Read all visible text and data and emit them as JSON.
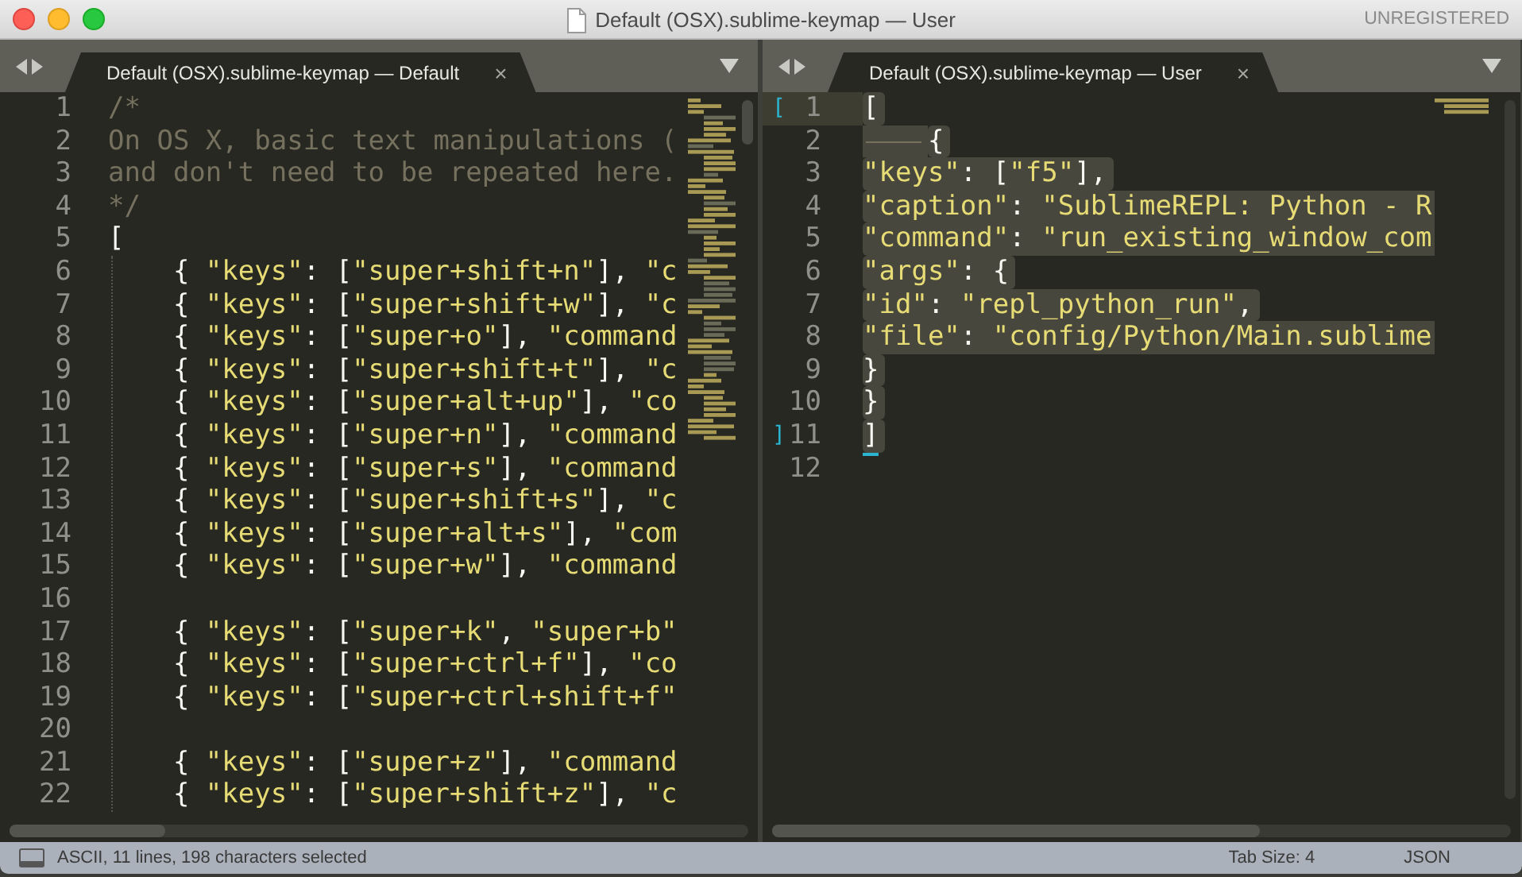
{
  "window": {
    "title": "Default (OSX).sublime-keymap — User",
    "license": "UNREGISTERED"
  },
  "panes": [
    {
      "tab": {
        "label": "Default (OSX).sublime-keymap — Default",
        "close": "×"
      },
      "lines": [
        {
          "number": "1",
          "kind": "comment",
          "text": "/*"
        },
        {
          "number": "2",
          "kind": "comment",
          "text": "On OS X, basic text manipulations ("
        },
        {
          "number": "3",
          "kind": "comment",
          "text": "and don't need to be repeated here."
        },
        {
          "number": "4",
          "kind": "comment",
          "text": "*/"
        },
        {
          "number": "5",
          "kind": "code",
          "text": "["
        },
        {
          "number": "6",
          "kind": "code",
          "text": "    { \"keys\": [\"super+shift+n\"], \"c"
        },
        {
          "number": "7",
          "kind": "code",
          "text": "    { \"keys\": [\"super+shift+w\"], \"c"
        },
        {
          "number": "8",
          "kind": "code",
          "text": "    { \"keys\": [\"super+o\"], \"command"
        },
        {
          "number": "9",
          "kind": "code",
          "text": "    { \"keys\": [\"super+shift+t\"], \"c"
        },
        {
          "number": "10",
          "kind": "code",
          "text": "    { \"keys\": [\"super+alt+up\"], \"co"
        },
        {
          "number": "11",
          "kind": "code",
          "text": "    { \"keys\": [\"super+n\"], \"command"
        },
        {
          "number": "12",
          "kind": "code",
          "text": "    { \"keys\": [\"super+s\"], \"command"
        },
        {
          "number": "13",
          "kind": "code",
          "text": "    { \"keys\": [\"super+shift+s\"], \"c"
        },
        {
          "number": "14",
          "kind": "code",
          "text": "    { \"keys\": [\"super+alt+s\"], \"com"
        },
        {
          "number": "15",
          "kind": "code",
          "text": "    { \"keys\": [\"super+w\"], \"command"
        },
        {
          "number": "16"
        },
        {
          "number": "17",
          "kind": "code",
          "text": "    { \"keys\": [\"super+k\", \"super+b\""
        },
        {
          "number": "18",
          "kind": "code",
          "text": "    { \"keys\": [\"super+ctrl+f\"], \"co"
        },
        {
          "number": "19",
          "kind": "code",
          "text": "    { \"keys\": [\"super+ctrl+shift+f\""
        },
        {
          "number": "20"
        },
        {
          "number": "21",
          "kind": "code",
          "text": "    { \"keys\": [\"super+z\"], \"command"
        },
        {
          "number": "22",
          "kind": "code",
          "text": "    { \"keys\": [\"super+shift+z\"], \"c"
        }
      ]
    },
    {
      "tab": {
        "label": "Default (OSX).sublime-keymap — User",
        "close": "×"
      },
      "lines": [
        {
          "number": "1",
          "kind": "code",
          "text": "[",
          "selected": true,
          "current": true,
          "gutter_mark": "[",
          "bracket_match": true
        },
        {
          "number": "2",
          "kind": "code",
          "text": "{",
          "selected": true,
          "tab_marker": true
        },
        {
          "number": "3",
          "kind": "code",
          "text": "\"keys\": [\"f5\"],",
          "selected": true
        },
        {
          "number": "4",
          "kind": "code",
          "text": "\"caption\": \"SublimeREPL: Python - R",
          "selected": true
        },
        {
          "number": "5",
          "kind": "code",
          "text": "\"command\": \"run_existing_window_com",
          "selected": true
        },
        {
          "number": "6",
          "kind": "code",
          "text": "\"args\": {",
          "selected": true
        },
        {
          "number": "7",
          "kind": "code",
          "text": "\"id\": \"repl_python_run\",",
          "selected": true
        },
        {
          "number": "8",
          "kind": "code",
          "text": "\"file\": \"config/Python/Main.sublime",
          "selected": true
        },
        {
          "number": "9",
          "kind": "code",
          "text": "}",
          "selected": true
        },
        {
          "number": "10",
          "kind": "code",
          "text": "}",
          "selected": true
        },
        {
          "number": "11",
          "kind": "code",
          "text": "]",
          "selected": true,
          "gutter_mark": "]",
          "bracket_match": true
        },
        {
          "number": "12"
        }
      ]
    }
  ],
  "status_bar": {
    "message": "ASCII, 11 lines, 198 characters selected",
    "tab_size": "Tab Size: 4",
    "syntax": "JSON"
  }
}
